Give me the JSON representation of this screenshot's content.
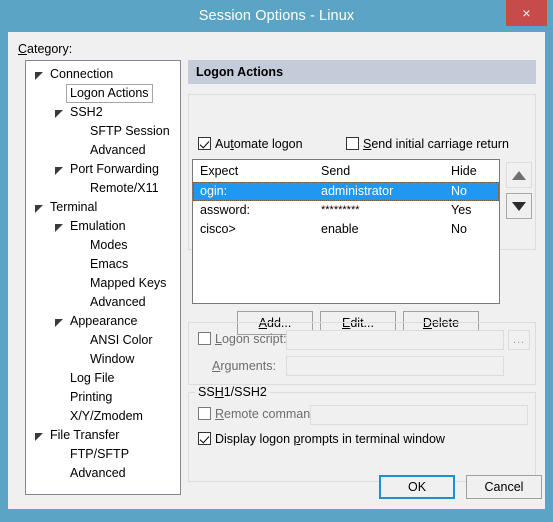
{
  "window": {
    "title": "Session Options - Linux",
    "close_label": "×",
    "accent_titlebar": "#5ba4c6",
    "close_button_color": "#c84b4b"
  },
  "sidebar": {
    "label": "Category:",
    "label_underline_char": "C",
    "items": [
      {
        "label": "Connection",
        "depth": 0,
        "expander": true,
        "selected": false
      },
      {
        "label": "Logon Actions",
        "depth": 1,
        "expander": false,
        "selected": true
      },
      {
        "label": "SSH2",
        "depth": 1,
        "expander": true,
        "selected": false
      },
      {
        "label": "SFTP Session",
        "depth": 2,
        "expander": false,
        "selected": false
      },
      {
        "label": "Advanced",
        "depth": 2,
        "expander": false,
        "selected": false
      },
      {
        "label": "Port Forwarding",
        "depth": 1,
        "expander": true,
        "selected": false
      },
      {
        "label": "Remote/X11",
        "depth": 2,
        "expander": false,
        "selected": false
      },
      {
        "label": "Terminal",
        "depth": 0,
        "expander": true,
        "selected": false
      },
      {
        "label": "Emulation",
        "depth": 1,
        "expander": true,
        "selected": false
      },
      {
        "label": "Modes",
        "depth": 2,
        "expander": false,
        "selected": false
      },
      {
        "label": "Emacs",
        "depth": 2,
        "expander": false,
        "selected": false
      },
      {
        "label": "Mapped Keys",
        "depth": 2,
        "expander": false,
        "selected": false
      },
      {
        "label": "Advanced",
        "depth": 2,
        "expander": false,
        "selected": false
      },
      {
        "label": "Appearance",
        "depth": 1,
        "expander": true,
        "selected": false
      },
      {
        "label": "ANSI Color",
        "depth": 2,
        "expander": false,
        "selected": false
      },
      {
        "label": "Window",
        "depth": 2,
        "expander": false,
        "selected": false
      },
      {
        "label": "Log File",
        "depth": 1,
        "expander": false,
        "selected": false
      },
      {
        "label": "Printing",
        "depth": 1,
        "expander": false,
        "selected": false
      },
      {
        "label": "X/Y/Zmodem",
        "depth": 1,
        "expander": false,
        "selected": false
      },
      {
        "label": "File Transfer",
        "depth": 0,
        "expander": true,
        "selected": false
      },
      {
        "label": "FTP/SFTP",
        "depth": 1,
        "expander": false,
        "selected": false
      },
      {
        "label": "Advanced",
        "depth": 1,
        "expander": false,
        "selected": false
      }
    ]
  },
  "panel": {
    "header": "Logon Actions",
    "automate_logon": {
      "label": "Automate logon",
      "checked": true,
      "accel": "t"
    },
    "send_initial_cr": {
      "label": "Send initial carriage return",
      "checked": false,
      "accel": "S"
    },
    "table": {
      "columns": [
        "Expect",
        "Send",
        "Hide"
      ],
      "rows": [
        {
          "expect": "ogin:",
          "send": "administrator",
          "hide": "No",
          "selected": true,
          "masked": false
        },
        {
          "expect": "assword:",
          "send": "*********",
          "hide": "Yes",
          "selected": false,
          "masked": true
        },
        {
          "expect": "cisco>",
          "send": "enable",
          "hide": "No",
          "selected": false,
          "masked": false
        }
      ],
      "selection_color": "#1e98f0"
    },
    "move_up_button": {
      "name": "move-up",
      "enabled": false
    },
    "move_down_button": {
      "name": "move-down",
      "enabled": true
    },
    "buttons": {
      "add": "Add...",
      "edit": "Edit...",
      "delete": "Delete"
    },
    "logon_script": {
      "checkbox_label": "Logon script:",
      "checked": false,
      "value": "",
      "browse_label": "..."
    },
    "arguments": {
      "label": "Arguments:",
      "value": ""
    },
    "ssh_group": {
      "title": "SSH1/SSH2",
      "remote_command": {
        "checkbox_label": "Remote command:",
        "checked": false,
        "value": ""
      },
      "display_prompts": {
        "label": "Display logon prompts in terminal window",
        "checked": true
      }
    }
  },
  "footer": {
    "ok": "OK",
    "cancel": "Cancel"
  }
}
